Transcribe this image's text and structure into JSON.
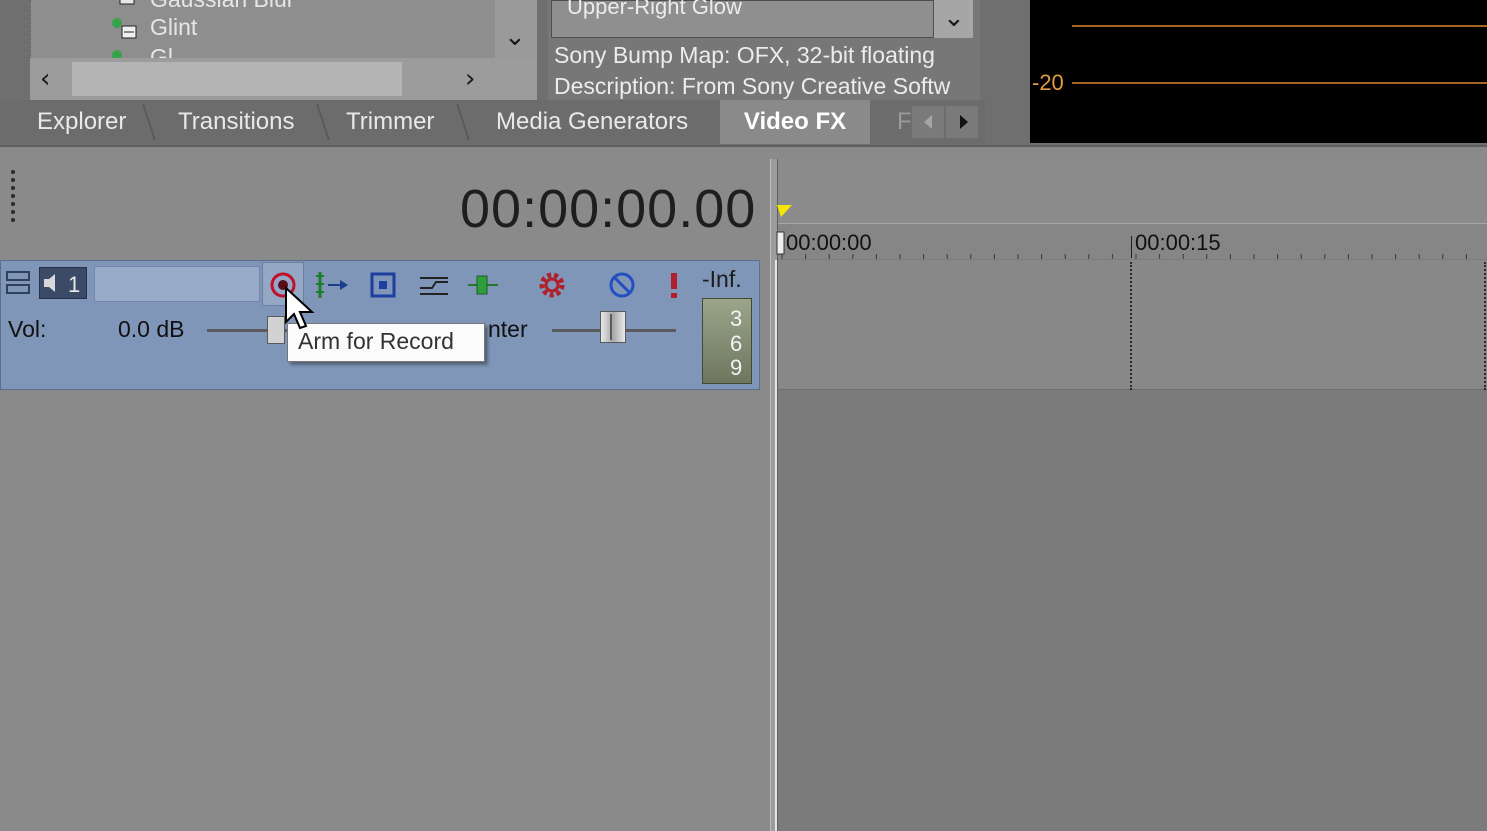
{
  "top_panels": {
    "tree": {
      "partial_top_item": "Gaussian Blur",
      "items": [
        "Glint"
      ],
      "partial_bottom_item": "Gl"
    },
    "fx_info": {
      "preset": "Upper-Right Glow",
      "plugin_line": "Sony Bump Map: OFX, 32-bit floating",
      "description_line": "Description: From Sony Creative Softw"
    },
    "meter": {
      "label": "-20"
    }
  },
  "tabs": [
    {
      "label": "Explorer",
      "active": false
    },
    {
      "label": "Transitions",
      "active": false
    },
    {
      "label": "Trimmer",
      "active": false
    },
    {
      "label": "Media Generators",
      "active": false
    },
    {
      "label": "Video FX",
      "active": true
    },
    {
      "label": "F",
      "active": false
    }
  ],
  "timeline": {
    "time_display": "00:00:00.00",
    "ruler_labels": [
      "00:00:00",
      "00:00:15"
    ]
  },
  "track": {
    "number": "1",
    "name": "",
    "volume_label": "Vol:",
    "volume_value": "0.0 dB",
    "pan_label": "Center",
    "pan_visible": "nter",
    "peak_label": "-Inf.",
    "meter_ticks": [
      "3",
      "6",
      "9"
    ]
  },
  "tooltip": {
    "text": "Arm for Record"
  },
  "colors": {
    "track_header": "#8096b8",
    "meter_line": "#a46422",
    "playhead_marker": "#f5e500",
    "record_button": "#c0102a"
  }
}
